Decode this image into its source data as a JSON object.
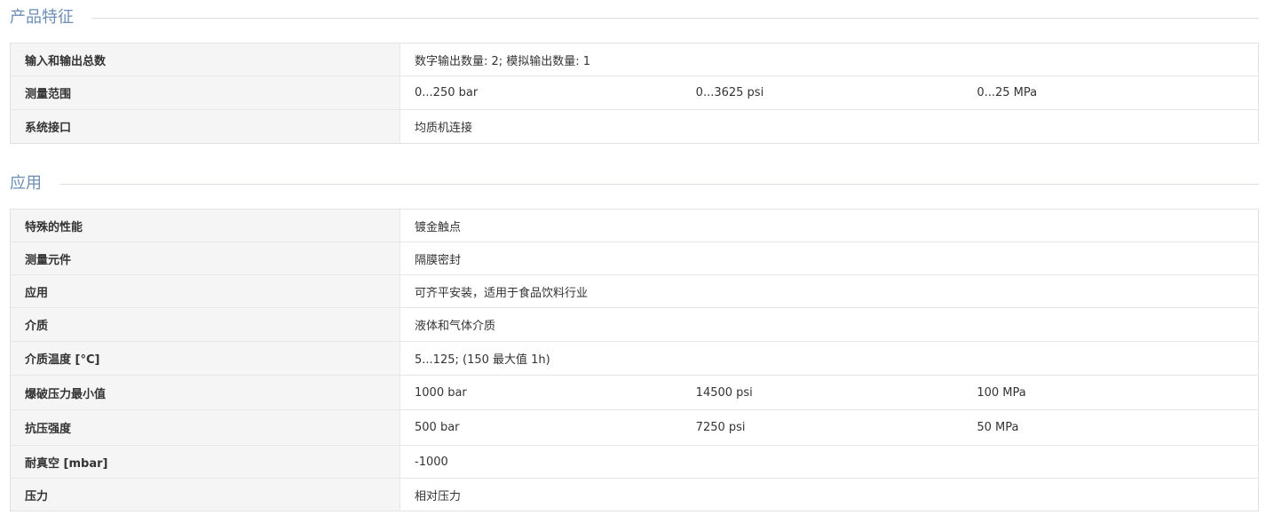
{
  "features": {
    "title": "产品特征",
    "rows": [
      {
        "label": "输入和输出总数",
        "values": [
          "数字输出数量: 2; 模拟输出数量: 1"
        ]
      },
      {
        "label": "测量范围",
        "values": [
          "0...250 bar",
          "0...3625 psi",
          "0...25 MPa"
        ]
      },
      {
        "label": "系统接口",
        "values": [
          "均质机连接"
        ]
      }
    ]
  },
  "application": {
    "title": "应用",
    "rows": [
      {
        "label": "特殊的性能",
        "values": [
          "镀金触点"
        ]
      },
      {
        "label": "测量元件",
        "values": [
          "隔膜密封"
        ]
      },
      {
        "label": "应用",
        "values": [
          "可齐平安装，适用于食品饮料行业"
        ]
      },
      {
        "label": "介质",
        "values": [
          "液体和气体介质"
        ]
      },
      {
        "label": "介质温度 [°C]",
        "values": [
          "5...125; (150 最大值 1h)"
        ]
      },
      {
        "label": "爆破压力最小值",
        "values": [
          "1000 bar",
          "14500 psi",
          "100 MPa"
        ]
      },
      {
        "label": "抗压强度",
        "values": [
          "500 bar",
          "7250 psi",
          "50 MPa"
        ]
      },
      {
        "label": "耐真空 [mbar]",
        "values": [
          "-1000"
        ]
      },
      {
        "label": "压力",
        "values": [
          "相对压力"
        ]
      }
    ]
  }
}
